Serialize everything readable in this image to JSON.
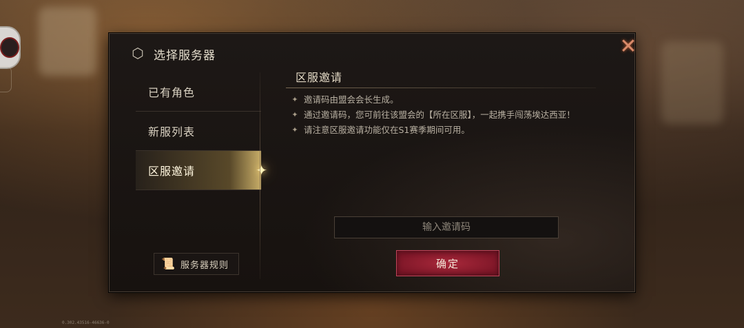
{
  "dialog": {
    "title": "选择服务器",
    "close_icon": "close-icon"
  },
  "sidebar": {
    "items": [
      {
        "label": "已有角色",
        "active": false
      },
      {
        "label": "新服列表",
        "active": false
      },
      {
        "label": "区服邀请",
        "active": true
      }
    ],
    "rules_button": "服务器规则"
  },
  "content": {
    "section_title": "区服邀请",
    "bullets": [
      "邀请码由盟会会长生成。",
      "通过邀请码，您可前往该盟会的【所在区服】，一起携手闯荡埃达西亚！",
      "请注意区服邀请功能仅在S1赛季期间可用。"
    ],
    "invite_input": {
      "placeholder": "输入邀请码",
      "value": ""
    },
    "confirm_button": "确定"
  },
  "footer": {
    "version": "0.302.43516-46636-0"
  },
  "colors": {
    "confirm_button": "#8e1c2f",
    "title_text": "#e4ddcc",
    "close_icon": "#d98a6a"
  }
}
